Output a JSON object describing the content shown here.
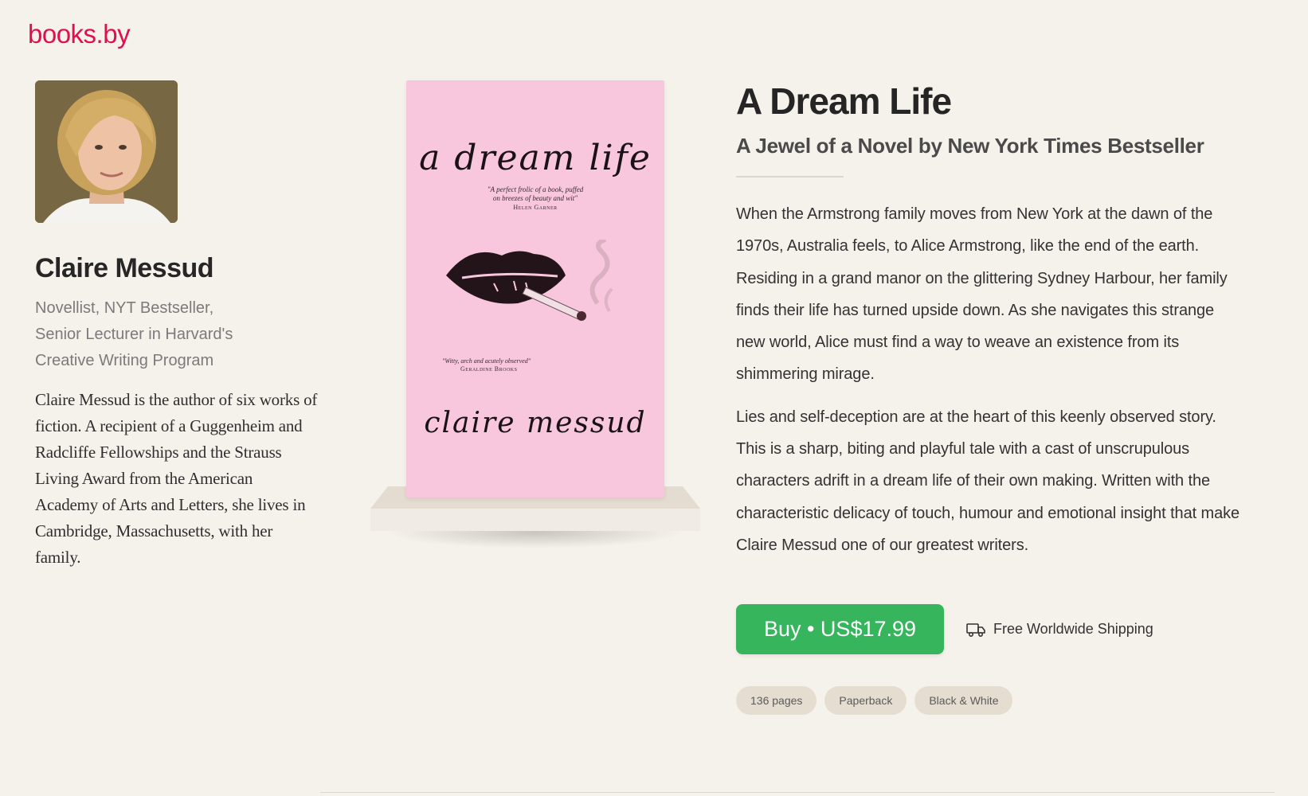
{
  "site": {
    "logo": "books.by"
  },
  "author": {
    "name": "Claire Messud",
    "role": "Novellist, NYT Bestseller, Senior Lecturer in Harvard's Creative Writing Program",
    "bio": "Claire Messud is the author of six works of fiction. A recipient of a Guggenheim and Radcliffe Fellowships and the Strauss Living Award from the American Academy of Arts and Letters, she lives in Cambridge, Massachusetts, with her family."
  },
  "cover": {
    "title": "a dream life",
    "quote1": "\"A perfect frolic of a book, puffed on breezes of beauty and wit\"",
    "quote1_attr": "Helen Garner",
    "quote2": "\"Witty, arch and acutely observed\"",
    "quote2_attr": "Geraldine Brooks",
    "author": "claire messud"
  },
  "book": {
    "title": "A Dream Life",
    "subtitle": "A Jewel of a Novel by New York Times Bestseller",
    "description": [
      "When the Armstrong family moves from New York at the dawn of the 1970s, Australia feels, to Alice Armstrong, like the end of the earth. Residing in a grand manor on the glittering Sydney Harbour, her family finds their life has turned upside down. As she navigates this strange new world, Alice must find a way to weave an existence from its shimmering mirage.",
      "Lies and self-deception are at the heart of this keenly observed story. This is a sharp, biting and playful tale with a cast of unscrupulous characters adrift in a dream life of their own making. Written with the characteristic delicacy of touch, humour and emotional insight that make Claire Messud one of our greatest writers."
    ],
    "buy_label": "Buy • US$17.99",
    "shipping_label": "Free Worldwide Shipping",
    "shipping_icon": "truck-icon",
    "tags": [
      "136 pages",
      "Paperback",
      "Black & White"
    ]
  },
  "colors": {
    "brand": "#e0114a",
    "buy": "#36b55d",
    "cover": "#f8c6dd",
    "background": "#f5f1eb"
  }
}
